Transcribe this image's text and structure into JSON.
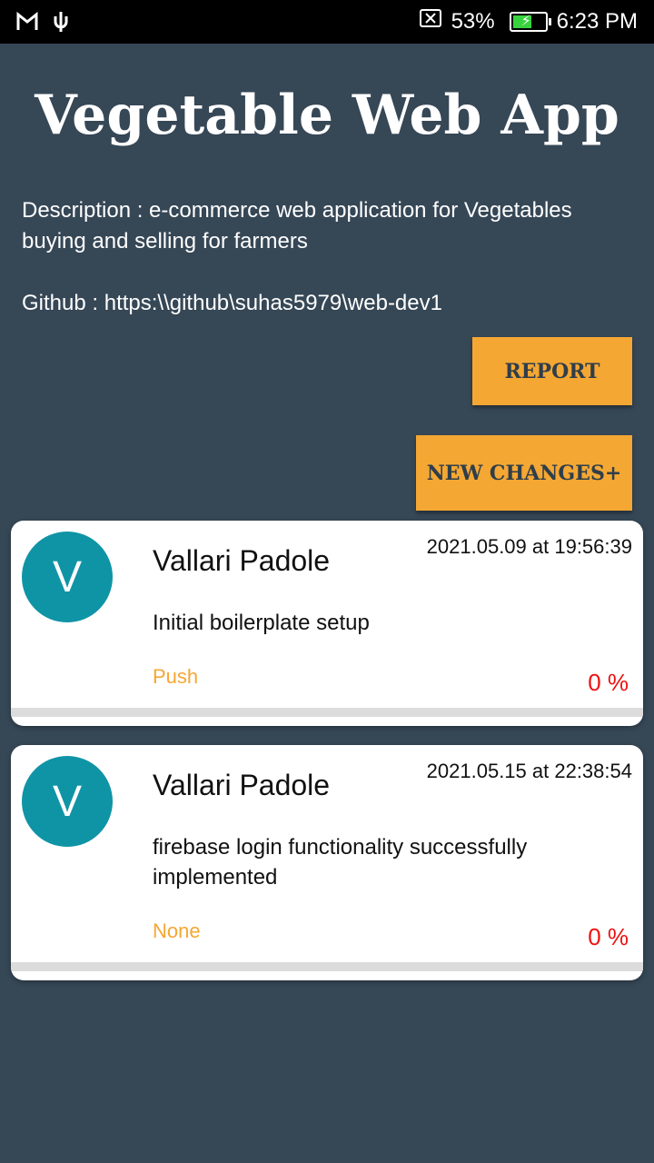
{
  "status_bar": {
    "battery_percent": "53%",
    "time": "6:23 PM",
    "battery_level": 0.53,
    "icons": [
      "gmail-icon",
      "usb-icon",
      "no-sim-icon",
      "battery-icon"
    ]
  },
  "app": {
    "title": "Vegetable Web App",
    "description": "Description : e-commerce web application for Vegetables buying and selling for farmers",
    "github": "Github : https:\\\\github\\suhas5979\\web-dev1"
  },
  "buttons": {
    "report": "REPORT",
    "new_changes": "NEW CHANGES+"
  },
  "commits": [
    {
      "avatar": "V",
      "name": "Vallari Padole",
      "date": "2021.05.09 at 19:56:39",
      "message": "Initial boilerplate setup",
      "type": "Push",
      "percent": "0 %"
    },
    {
      "avatar": "V",
      "name": "Vallari Padole",
      "date": "2021.05.15 at 22:38:54",
      "message": "firebase login functionality successfully implemented",
      "type": "None",
      "percent": "0 %"
    }
  ],
  "colors": {
    "background": "#364756",
    "accent": "#f5a733",
    "avatar": "#0f94a6",
    "percent": "#ee1111"
  }
}
